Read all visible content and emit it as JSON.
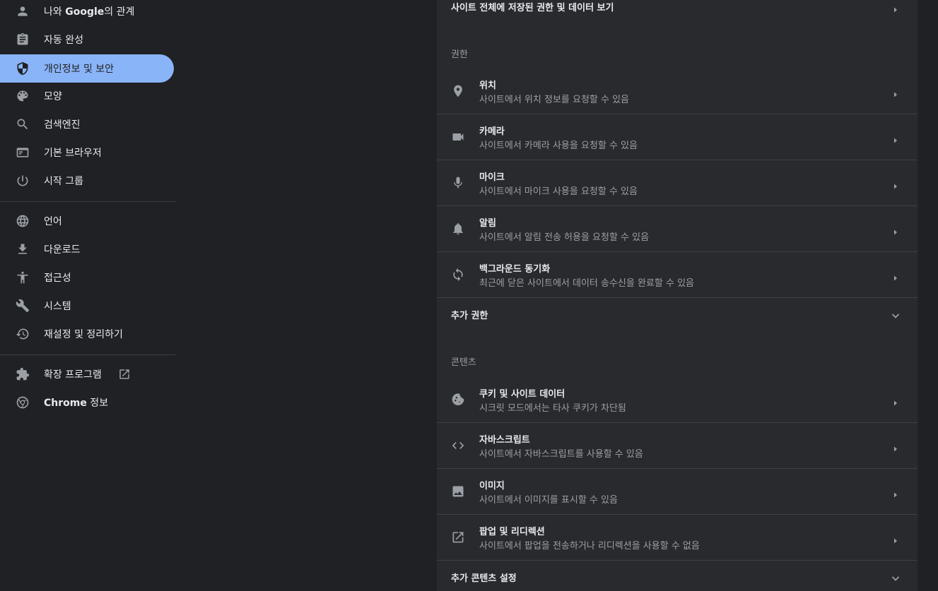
{
  "sidebar": {
    "items": [
      {
        "label_prefix": "나와 ",
        "label_bold": "Google",
        "label_suffix": "의 관계",
        "icon": "person-icon"
      },
      {
        "label": "자동 완성",
        "icon": "clipboard-icon"
      },
      {
        "label": "개인정보 및 보안",
        "icon": "shield-icon",
        "selected": true
      },
      {
        "label": "모양",
        "icon": "palette-icon"
      },
      {
        "label": "검색엔진",
        "icon": "search-icon"
      },
      {
        "label": "기본 브라우저",
        "icon": "browser-icon"
      },
      {
        "label": "시작 그룹",
        "icon": "power-icon"
      },
      {
        "label": "언어",
        "icon": "globe-icon"
      },
      {
        "label": "다운로드",
        "icon": "download-icon"
      },
      {
        "label": "접근성",
        "icon": "accessibility-icon"
      },
      {
        "label": "시스템",
        "icon": "wrench-icon"
      },
      {
        "label": "재설정 및 정리하기",
        "icon": "history-icon"
      },
      {
        "label": "확장 프로그램",
        "icon": "puzzle-icon",
        "external": true
      },
      {
        "label_bold": "Chrome",
        "label_suffix": " 정보",
        "icon": "chrome-icon"
      }
    ]
  },
  "main": {
    "top_row": {
      "title": "사이트 전체에 저장된 권한 및 데이터 보기"
    },
    "permissions_label": "권한",
    "permissions": [
      {
        "title": "위치",
        "sub": "사이트에서 위치 정보를 요청할 수 있음",
        "icon": "location-pin-icon"
      },
      {
        "title": "카메라",
        "sub": "사이트에서 카메라 사용을 요청할 수 있음",
        "icon": "camera-icon"
      },
      {
        "title": "마이크",
        "sub": "사이트에서 마이크 사용을 요청할 수 있음",
        "icon": "microphone-icon"
      },
      {
        "title": "알림",
        "sub": "사이트에서 알림 전송 허용을 요청할 수 있음",
        "icon": "bell-icon"
      },
      {
        "title": "백그라운드 동기화",
        "sub": "최근에 닫은 사이트에서 데이터 송수신을 완료할 수 있음",
        "icon": "sync-icon"
      }
    ],
    "more_permissions": "추가 권한",
    "content_label": "콘텐츠",
    "content": [
      {
        "title": "쿠키 및 사이트 데이터",
        "sub": "시크릿 모드에서는 타사 쿠키가 차단됨",
        "icon": "cookie-icon"
      },
      {
        "title": "자바스크립트",
        "sub": "사이트에서 자바스크립트를 사용할 수 있음",
        "icon": "code-icon"
      },
      {
        "title": "이미지",
        "sub": "사이트에서 이미지를 표시할 수 있음",
        "icon": "image-icon"
      },
      {
        "title": "팝업 및 리디렉션",
        "sub": "사이트에서 팝업을 전송하거나 리디렉션을 사용할 수 없음",
        "icon": "open-in-new-icon"
      }
    ],
    "more_content": "추가 콘텐츠 설정"
  }
}
